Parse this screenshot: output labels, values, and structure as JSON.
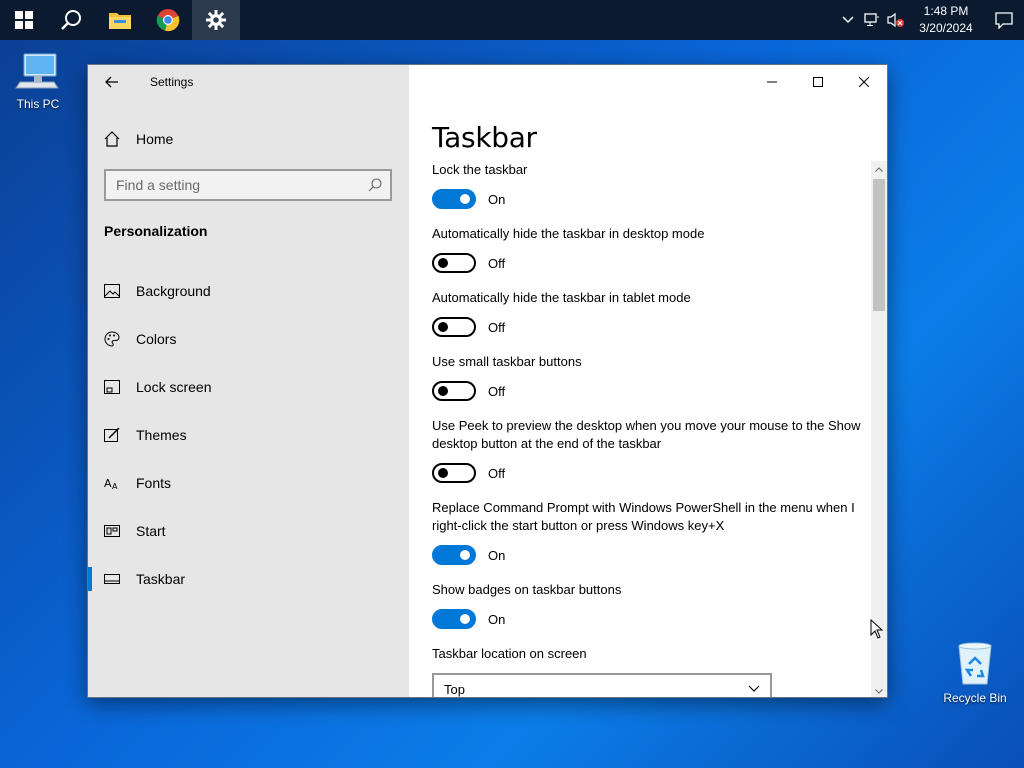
{
  "taskbar": {
    "clock_time": "1:48 PM",
    "clock_date": "3/20/2024",
    "icons": [
      "windows-start-icon",
      "search-icon",
      "file-explorer-icon",
      "chrome-icon",
      "settings-gear-icon"
    ]
  },
  "desktop": {
    "this_pc": "This PC",
    "recycle_bin": "Recycle Bin"
  },
  "window": {
    "app_title": "Settings",
    "home_label": "Home",
    "search_placeholder": "Find a setting",
    "section_title": "Personalization",
    "nav": [
      {
        "label": "Background",
        "icon": "image-icon"
      },
      {
        "label": "Colors",
        "icon": "palette-icon"
      },
      {
        "label": "Lock screen",
        "icon": "lock-screen-icon"
      },
      {
        "label": "Themes",
        "icon": "themes-icon"
      },
      {
        "label": "Fonts",
        "icon": "fonts-icon"
      },
      {
        "label": "Start",
        "icon": "start-icon"
      },
      {
        "label": "Taskbar",
        "icon": "taskbar-icon"
      }
    ],
    "selected_nav": "Taskbar"
  },
  "content": {
    "page_title": "Taskbar",
    "settings": [
      {
        "label": "Lock the taskbar",
        "state": "On"
      },
      {
        "label": "Automatically hide the taskbar in desktop mode",
        "state": "Off"
      },
      {
        "label": "Automatically hide the taskbar in tablet mode",
        "state": "Off"
      },
      {
        "label": "Use small taskbar buttons",
        "state": "Off"
      },
      {
        "label": "Use Peek to preview the desktop when you move your mouse to the Show desktop button at the end of the taskbar",
        "state": "Off"
      },
      {
        "label": "Replace Command Prompt with Windows PowerShell in the menu when I right-click the start button or press Windows key+X",
        "state": "On"
      },
      {
        "label": "Show badges on taskbar buttons",
        "state": "On"
      }
    ],
    "location_label": "Taskbar location on screen",
    "location_value": "Top"
  },
  "colors": {
    "accent": "#0078d7",
    "taskbar_bg": "#0b1a2e",
    "sidebar_bg": "#e6e6e6"
  }
}
